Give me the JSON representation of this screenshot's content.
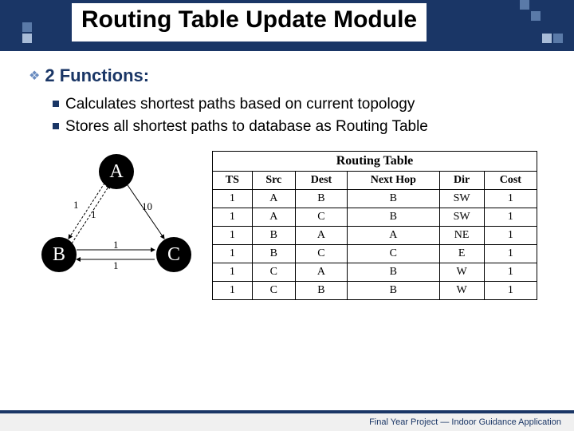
{
  "title": "Routing Table Update Module",
  "heading": "2 Functions:",
  "bullets": [
    "Calculates shortest paths based on current topology",
    "Stores all shortest paths to database as Routing Table"
  ],
  "graph": {
    "nodes": {
      "a": "A",
      "b": "B",
      "c": "C"
    },
    "edges": {
      "ab1": "1",
      "ab2": "1",
      "bc_top": "1",
      "bc_bot": "1",
      "ac": "10"
    }
  },
  "table": {
    "caption": "Routing Table",
    "headers": [
      "TS",
      "Src",
      "Dest",
      "Next Hop",
      "Dir",
      "Cost"
    ],
    "rows": [
      [
        "1",
        "A",
        "B",
        "B",
        "SW",
        "1"
      ],
      [
        "1",
        "A",
        "C",
        "B",
        "SW",
        "1"
      ],
      [
        "1",
        "B",
        "A",
        "A",
        "NE",
        "1"
      ],
      [
        "1",
        "B",
        "C",
        "C",
        "E",
        "1"
      ],
      [
        "1",
        "C",
        "A",
        "B",
        "W",
        "1"
      ],
      [
        "1",
        "C",
        "B",
        "B",
        "W",
        "1"
      ]
    ]
  },
  "footer": "Final Year Project — Indoor Guidance Application"
}
